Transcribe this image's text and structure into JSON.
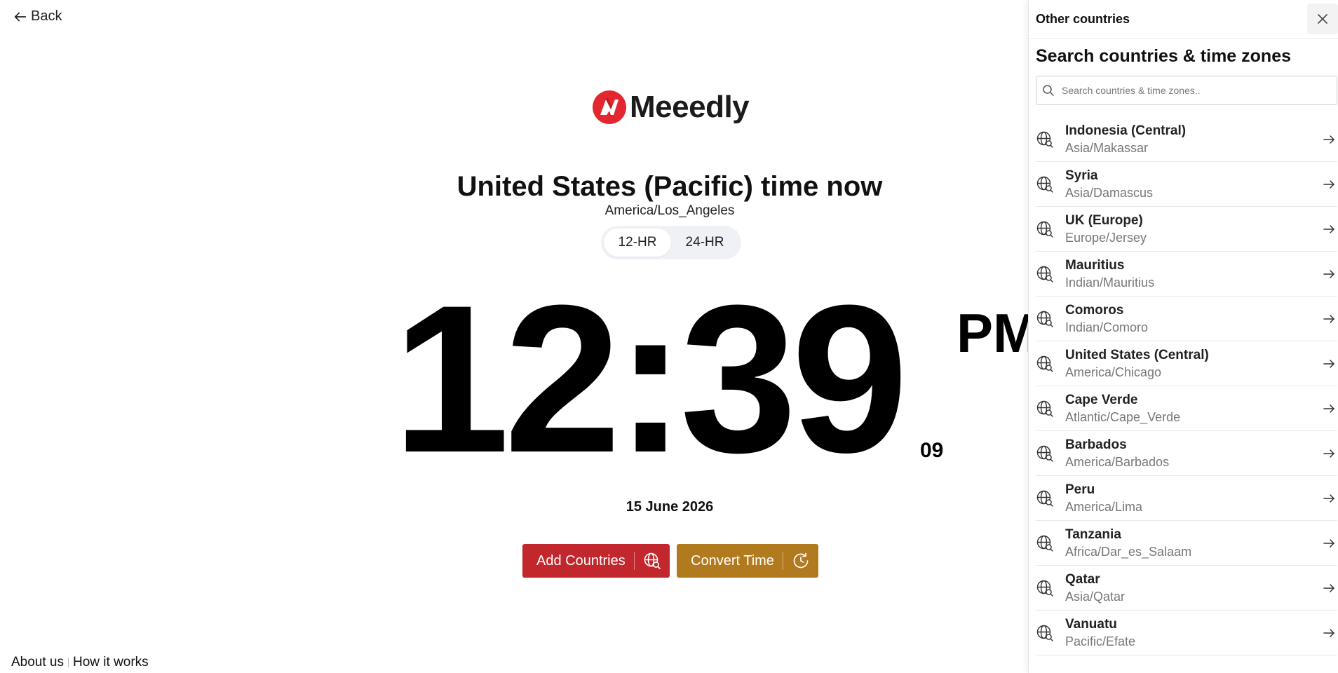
{
  "nav": {
    "back_label": "Back"
  },
  "brand": {
    "name": "Meeedly",
    "color": "#e3262f"
  },
  "header": {
    "title": "United States (Pacific) time now",
    "timezone": "America/Los_Angeles"
  },
  "format_toggle": {
    "options": [
      {
        "label": "12-HR",
        "active": true
      },
      {
        "label": "24-HR",
        "active": false
      }
    ]
  },
  "clock": {
    "time": "12:39",
    "seconds": "09",
    "meridiem": "PM",
    "date": "15 June 2026"
  },
  "actions": {
    "add_countries_label": "Add Countries",
    "add_countries_color": "#c2272d",
    "convert_time_label": "Convert Time",
    "convert_time_color": "#b17a1e"
  },
  "footer": {
    "links": [
      "About us",
      "How it works"
    ]
  },
  "panel": {
    "title": "Other countries",
    "heading": "Search countries & time zones",
    "search_placeholder": "Search countries & time zones..",
    "items": [
      {
        "country": "Indonesia (Central)",
        "zone": "Asia/Makassar"
      },
      {
        "country": "Syria",
        "zone": "Asia/Damascus"
      },
      {
        "country": "UK (Europe)",
        "zone": "Europe/Jersey"
      },
      {
        "country": "Mauritius",
        "zone": "Indian/Mauritius"
      },
      {
        "country": "Comoros",
        "zone": "Indian/Comoro"
      },
      {
        "country": "United States (Central)",
        "zone": "America/Chicago"
      },
      {
        "country": "Cape Verde",
        "zone": "Atlantic/Cape_Verde"
      },
      {
        "country": "Barbados",
        "zone": "America/Barbados"
      },
      {
        "country": "Peru",
        "zone": "America/Lima"
      },
      {
        "country": "Tanzania",
        "zone": "Africa/Dar_es_Salaam"
      },
      {
        "country": "Qatar",
        "zone": "Asia/Qatar"
      },
      {
        "country": "Vanuatu",
        "zone": "Pacific/Efate"
      }
    ]
  }
}
